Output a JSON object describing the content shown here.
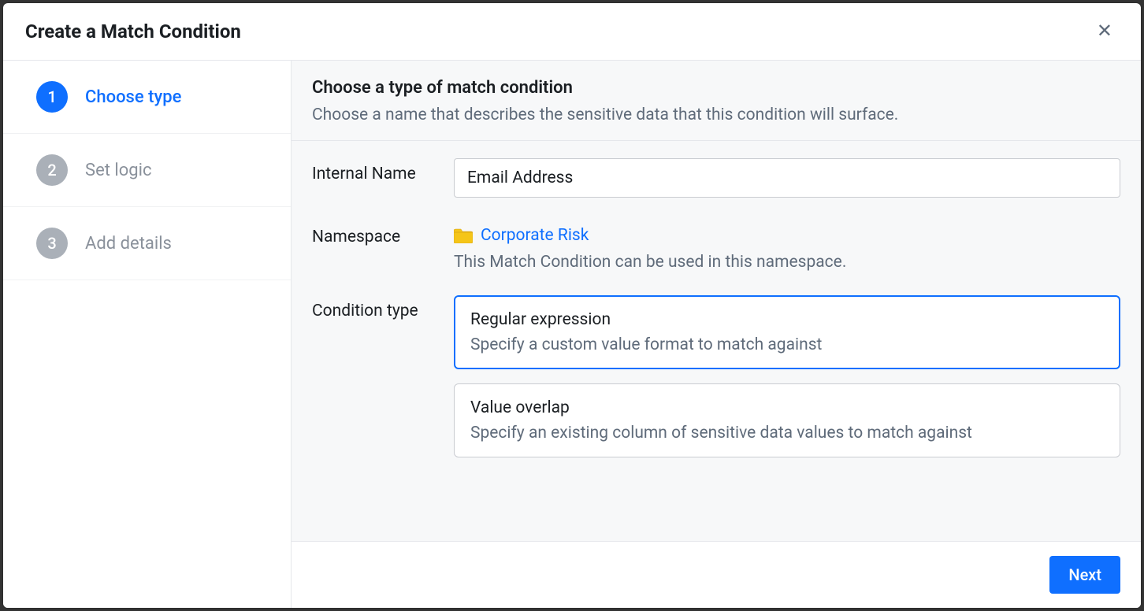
{
  "header": {
    "title": "Create a Match Condition"
  },
  "steps": [
    {
      "number": "1",
      "label": "Choose type",
      "active": true
    },
    {
      "number": "2",
      "label": "Set logic",
      "active": false
    },
    {
      "number": "3",
      "label": "Add details",
      "active": false
    }
  ],
  "main": {
    "title": "Choose a type of match condition",
    "subtitle": "Choose a name that describes the sensitive data that this condition will surface."
  },
  "form": {
    "internal_name": {
      "label": "Internal Name",
      "value": "Email Address"
    },
    "namespace": {
      "label": "Namespace",
      "link_text": "Corporate Risk",
      "hint": "This Match Condition can be used in this namespace."
    },
    "condition_type": {
      "label": "Condition type",
      "options": [
        {
          "title": "Regular expression",
          "description": "Specify a custom value format to match against",
          "selected": true
        },
        {
          "title": "Value overlap",
          "description": "Specify an existing column of sensitive data values to match against",
          "selected": false
        }
      ]
    }
  },
  "footer": {
    "next_label": "Next"
  }
}
